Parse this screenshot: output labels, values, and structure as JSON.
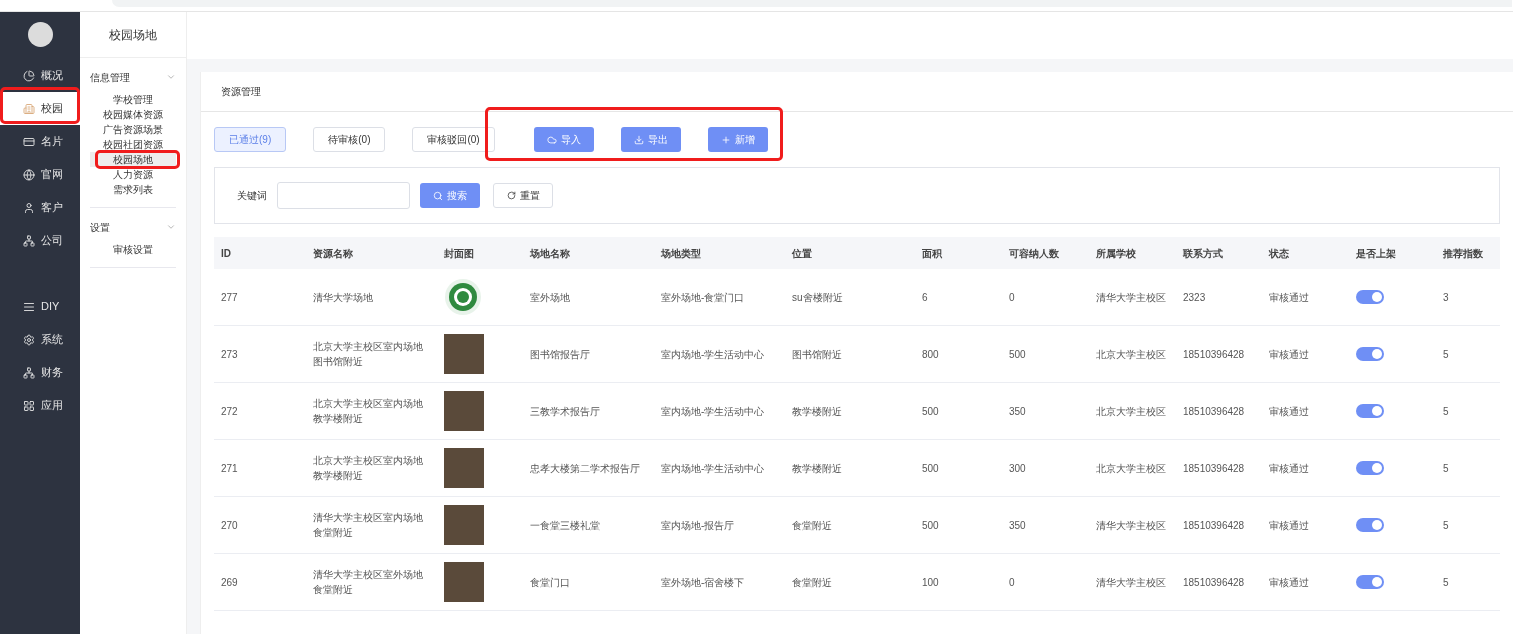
{
  "nav": [
    {
      "label": "概况",
      "selected": false
    },
    {
      "label": "校园",
      "selected": true
    },
    {
      "label": "名片",
      "selected": false
    },
    {
      "label": "官网",
      "selected": false
    },
    {
      "label": "客户",
      "selected": false
    },
    {
      "label": "公司",
      "selected": false
    },
    {
      "label": "DIY",
      "selected": false
    },
    {
      "label": "系统",
      "selected": false
    },
    {
      "label": "财务",
      "selected": false
    },
    {
      "label": "应用",
      "selected": false
    }
  ],
  "submenu": {
    "title": "校园场地",
    "groups": [
      {
        "label": "信息管理",
        "expanded": true,
        "items": [
          {
            "label": "学校管理",
            "selected": false
          },
          {
            "label": "校园媒体资源",
            "selected": false
          },
          {
            "label": "广告资源场景",
            "selected": false
          },
          {
            "label": "校园社团资源",
            "selected": false
          },
          {
            "label": "校园场地",
            "selected": true
          },
          {
            "label": "人力资源",
            "selected": false
          },
          {
            "label": "需求列表",
            "selected": false
          }
        ]
      },
      {
        "label": "设置",
        "expanded": true,
        "items": [
          {
            "label": "审核设置",
            "selected": false
          }
        ]
      }
    ]
  },
  "panel_title": "资源管理",
  "tabs": [
    {
      "label": "已通过(9)",
      "selected": true
    },
    {
      "label": "待审核(0)",
      "selected": false
    },
    {
      "label": "审核驳回(0)",
      "selected": false
    }
  ],
  "actions": [
    {
      "label": "导入"
    },
    {
      "label": "导出"
    },
    {
      "label": "新增"
    }
  ],
  "filter": {
    "label": "关键词",
    "search": "搜索",
    "reset": "重置"
  },
  "table": {
    "columns": [
      "ID",
      "资源名称",
      "封面图",
      "场地名称",
      "场地类型",
      "位置",
      "面积",
      "可容纳人数",
      "所属学校",
      "联系方式",
      "状态",
      "是否上架",
      "推荐指数"
    ],
    "rows": [
      {
        "id": "277",
        "name": "清华大学场地",
        "kind": "emblem",
        "venue": "室外场地",
        "type": "室外场地-食堂门口",
        "location": "su舍楼附近",
        "area": "6",
        "capacity": "0",
        "school": "清华大学主校区",
        "contact": "2323",
        "status": "审核通过",
        "listed": true,
        "rating": "3"
      },
      {
        "id": "273",
        "name": "北京大学主校区室内场地图书馆附近",
        "kind": "photo",
        "venue": "图书馆报告厅",
        "type": "室内场地-学生活动中心",
        "location": "图书馆附近",
        "area": "800",
        "capacity": "500",
        "school": "北京大学主校区",
        "contact": "18510396428",
        "status": "审核通过",
        "listed": true,
        "rating": "5"
      },
      {
        "id": "272",
        "name": "北京大学主校区室内场地教学楼附近",
        "kind": "photo",
        "venue": "三教学术报告厅",
        "type": "室内场地-学生活动中心",
        "location": "教学楼附近",
        "area": "500",
        "capacity": "350",
        "school": "北京大学主校区",
        "contact": "18510396428",
        "status": "审核通过",
        "listed": true,
        "rating": "5"
      },
      {
        "id": "271",
        "name": "北京大学主校区室内场地教学楼附近",
        "kind": "photo",
        "venue": "忠孝大楼第二学术报告厅",
        "type": "室内场地-学生活动中心",
        "location": "教学楼附近",
        "area": "500",
        "capacity": "300",
        "school": "北京大学主校区",
        "contact": "18510396428",
        "status": "审核通过",
        "listed": true,
        "rating": "5"
      },
      {
        "id": "270",
        "name": "清华大学主校区室内场地食堂附近",
        "kind": "photo",
        "venue": "一食堂三楼礼堂",
        "type": "室内场地-报告厅",
        "location": "食堂附近",
        "area": "500",
        "capacity": "350",
        "school": "清华大学主校区",
        "contact": "18510396428",
        "status": "审核通过",
        "listed": true,
        "rating": "5"
      },
      {
        "id": "269",
        "name": "清华大学主校区室外场地食堂附近",
        "kind": "photo",
        "venue": "食堂门口",
        "type": "室外场地-宿舍楼下",
        "location": "食堂附近",
        "area": "100",
        "capacity": "0",
        "school": "清华大学主校区",
        "contact": "18510396428",
        "status": "审核通过",
        "listed": true,
        "rating": "5"
      }
    ]
  }
}
